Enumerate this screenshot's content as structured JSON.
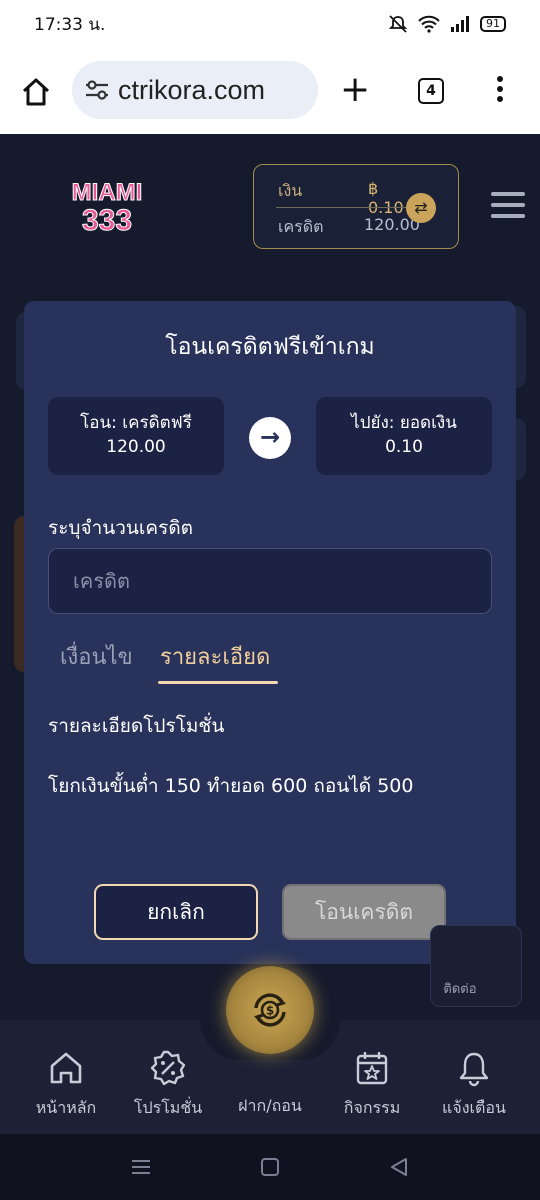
{
  "status": {
    "time": "17:33 น.",
    "battery": "91"
  },
  "browser": {
    "url": "ctrikora.com",
    "tab_count": "4"
  },
  "wallet": {
    "money_label": "เงิน",
    "money_value": "฿ 0.10",
    "credit_label": "เครดิต",
    "credit_value": "120.00"
  },
  "modal": {
    "title": "โอนเครดิตฟรีเข้าเกม",
    "from_label": "โอน: เครดิตฟรี",
    "from_value": "120.00",
    "to_label": "ไปยัง: ยอดเงิน",
    "to_value": "0.10",
    "amount_label": "ระบุจำนวนเครดิต",
    "amount_placeholder": "เครดิต",
    "tabs": [
      "เงื่อนไข",
      "รายละเอียด"
    ],
    "active_tab": "รายละเอียด",
    "promo_title": "รายละเอียดโปรโมชั่น",
    "promo_text": "โยกเงินขั้นต่ำ 150 ทำยอด 600 ถอนได้ 500",
    "cancel_label": "ยกเลิก",
    "transfer_label": "โอนเครดิต"
  },
  "contact_label": "ติดต่อ",
  "nav": [
    {
      "label": "หน้าหลัก",
      "icon": "home-icon"
    },
    {
      "label": "โปรโมชั่น",
      "icon": "percent-badge-icon"
    },
    {
      "label": "ฝาก/ถอน",
      "icon": "coin-exchange-icon"
    },
    {
      "label": "กิจกรรม",
      "icon": "calendar-star-icon"
    },
    {
      "label": "แจ้งเตือน",
      "icon": "bell-icon"
    }
  ],
  "colors": {
    "accent": "#f0cf9f",
    "modal_bg": "#28325a",
    "page_bg": "#151a2c",
    "gold": "#c9a653"
  }
}
